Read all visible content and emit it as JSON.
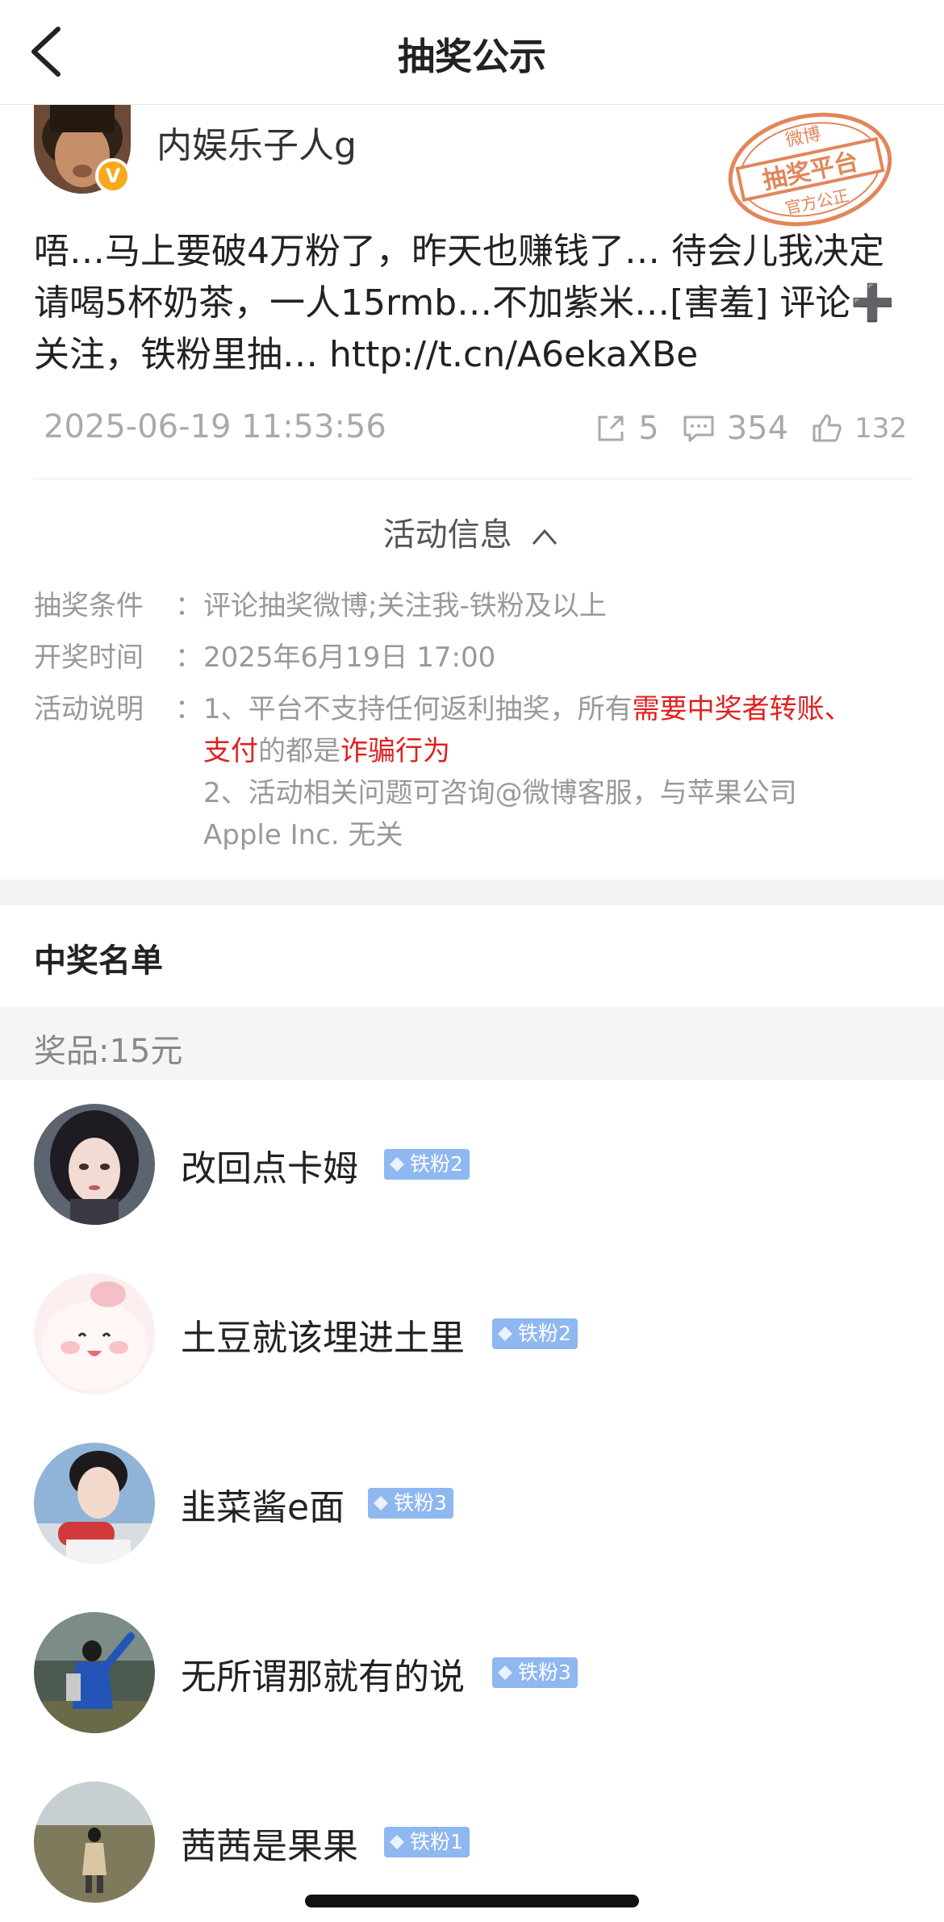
{
  "nav": {
    "title": "抽奖公示"
  },
  "post": {
    "author": "内娱乐子人g",
    "verify_mark": "V",
    "stamp": {
      "top": "微博",
      "middle": "抽奖平台",
      "bottom": "官方公正"
    },
    "text_line1": "唔…马上要破4万粉了，昨天也赚钱了… 待会儿我决定",
    "text_line2": "请喝5杯奶茶，一人15rmb…不加紫米…[害羞] 评论",
    "text_plus": "➕",
    "text_line3": "关注，铁粉里抽…  http://t.cn/A6ekaXBe",
    "time": "2025-06-19 11:53:56",
    "reposts": "5",
    "comments": "354",
    "likes": "132"
  },
  "activity": {
    "toggle_label": "活动信息",
    "condition_label": "抽奖条件",
    "condition_value": "评论抽奖微博;关注我-铁粉及以上",
    "time_label": "开奖时间",
    "time_value": "2025年6月19日 17:00",
    "desc_label": "活动说明",
    "desc_1a": "1、平台不支持任何返利抽奖，所有",
    "desc_1b": "需要中奖者转账、",
    "desc_1c": "支付",
    "desc_1d": "的都是",
    "desc_1e": "诈骗行为",
    "desc_2a": "2、活动相关问题可咨询@微博客服，与苹果公司",
    "desc_2b": "Apple Inc. 无关",
    "colon": "："
  },
  "winners": {
    "title": "中奖名单",
    "prize": "奖品:15元",
    "list": [
      {
        "name": "改回点卡姆",
        "badge": "铁粉2"
      },
      {
        "name": "土豆就该埋进土里",
        "badge": "铁粉2"
      },
      {
        "name": "韭菜酱e面",
        "badge": "铁粉3"
      },
      {
        "name": "无所谓那就有的说",
        "badge": "铁粉3"
      },
      {
        "name": "茜茜是果果",
        "badge": "铁粉1"
      }
    ]
  },
  "colors": {
    "warning_red": "#e02020",
    "badge_blue": "#8fb7f0",
    "verify_orange": "#f7a91b",
    "stamp_orange": "#e2865a"
  }
}
